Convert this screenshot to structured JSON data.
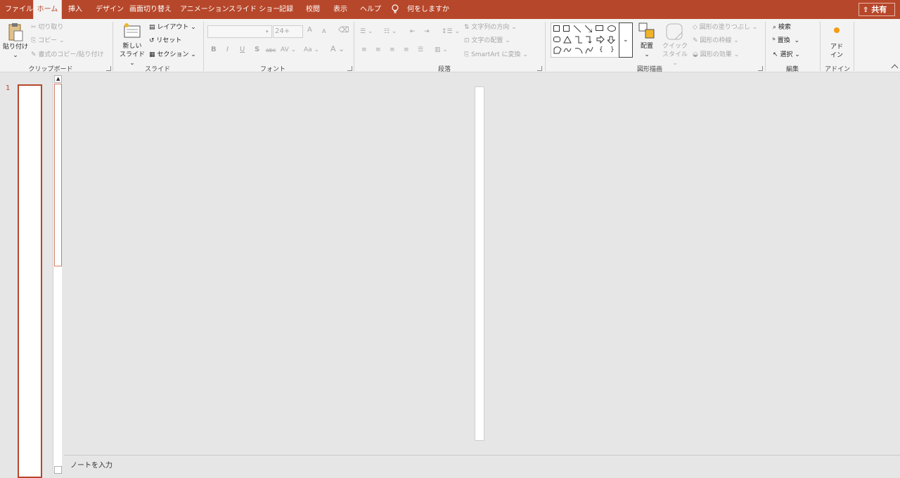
{
  "tabs": [
    "ファイル",
    "ホーム",
    "挿入",
    "デザイン",
    "画面切り替え",
    "アニメーション",
    "スライド ショー",
    "記録",
    "校閲",
    "表示",
    "ヘルプ"
  ],
  "tell_me": "何をしますか",
  "share": "共有",
  "ribbon": {
    "clipboard": {
      "paste": "貼り付け",
      "cut": "切り取り",
      "copy": "コピー",
      "format_painter": "書式のコピー/貼り付け",
      "label": "クリップボード"
    },
    "slides": {
      "new_slide_1": "新しい",
      "new_slide_2": "スライド",
      "layout": "レイアウト",
      "reset": "リセット",
      "section": "セクション",
      "label": "スライド"
    },
    "font": {
      "font_size": "24+",
      "bold": "B",
      "italic": "I",
      "underline": "U",
      "shadow": "S",
      "strike": "abc",
      "spacing": "AV",
      "case": "Aa",
      "color": "A",
      "grow": "A",
      "shrink": "A",
      "label": "フォント"
    },
    "paragraph": {
      "text_direction": "文字列の方向",
      "align_text": "文字の配置",
      "smartart": "SmartArt に変換",
      "label": "段落"
    },
    "drawing": {
      "arrange": "配置",
      "quick_styles_1": "クイック",
      "quick_styles_2": "スタイル",
      "fill": "図形の塗りつぶし",
      "outline": "図形の枠線",
      "effects": "図形の効果",
      "label": "図形描画"
    },
    "editing": {
      "find": "検索",
      "replace": "置換",
      "select": "選択",
      "label": "編集"
    },
    "addins": {
      "addin_1": "アド",
      "addin_2": "イン",
      "label": "アドイン"
    }
  },
  "slide_number": "1",
  "notes_placeholder": "ノートを入力",
  "colors": {
    "accent": "#b7472a",
    "ribbon": "#f3f3f3",
    "workspace": "#e6e6e6"
  }
}
